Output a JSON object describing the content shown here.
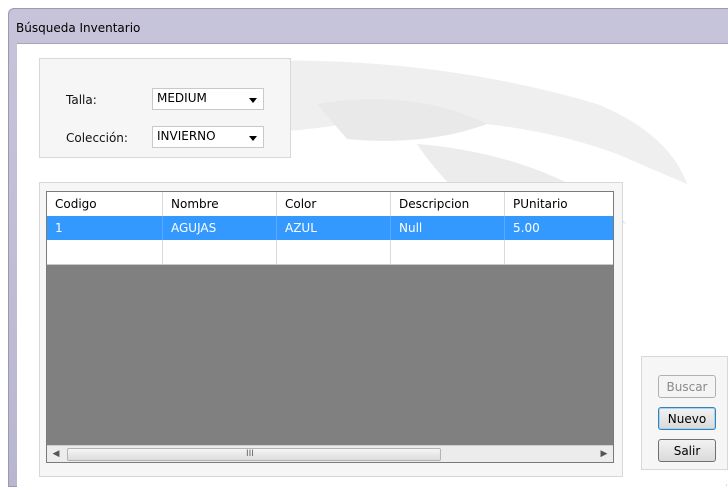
{
  "window": {
    "title": "Búsqueda Inventario"
  },
  "filters": {
    "talla": {
      "label": "Talla:",
      "value": "MEDIUM"
    },
    "coleccion": {
      "label": "Colección:",
      "value": "INVIERNO"
    }
  },
  "grid": {
    "columns": [
      "Codigo",
      "Nombre",
      "Color",
      "Descripcion",
      "PUnitario"
    ],
    "rows": [
      [
        "1",
        "AGUJAS",
        "AZUL",
        "Null",
        "5.00"
      ]
    ],
    "scroll_grip": "III"
  },
  "buttons": {
    "buscar": "Buscar",
    "nuevo": "Nuevo",
    "salir": "Salir"
  },
  "colors": {
    "selection": "#3399ff",
    "grid_background": "#808080",
    "window_frame": "#c7c4da"
  }
}
